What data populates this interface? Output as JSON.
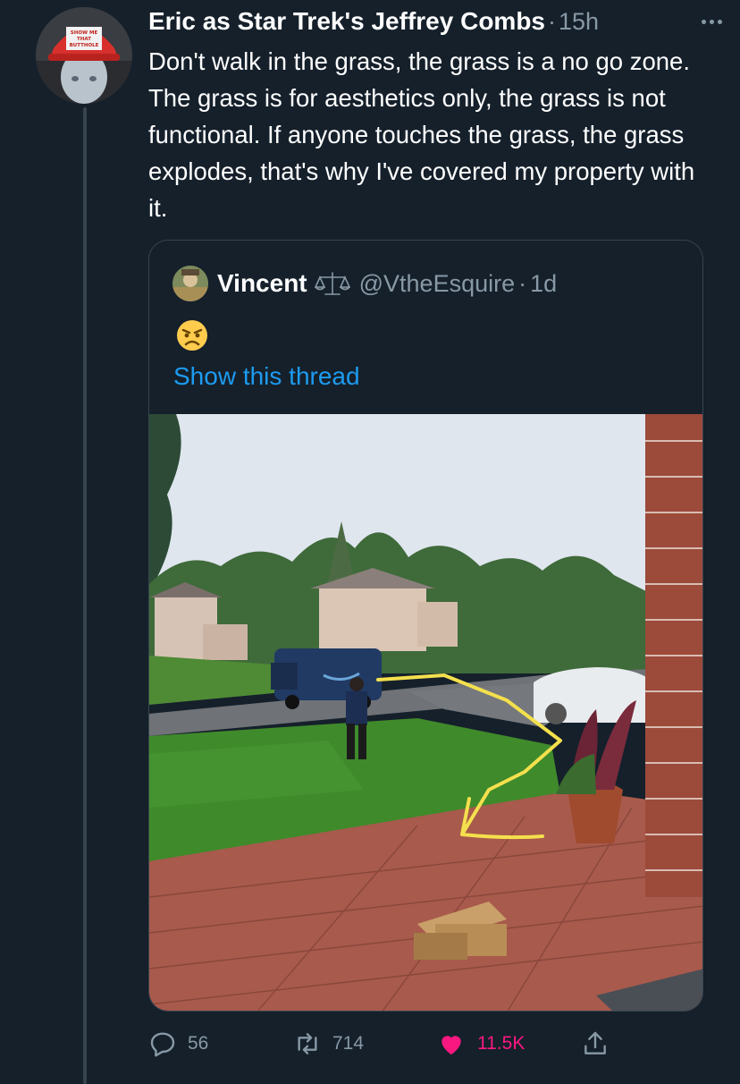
{
  "tweet": {
    "author": {
      "display_name": "Eric as Star Trek's Jeffrey Combs",
      "hat_text": [
        "SHOW ME",
        "THAT",
        "BUTTHOLE"
      ]
    },
    "separator": "·",
    "time": "15h",
    "text": "Don't walk in the grass, the grass is a no go zone. The grass is for aesthetics only, the grass is not functional. If anyone touches the grass, the grass explodes, that's why I've covered my property with it."
  },
  "quote": {
    "display_name": "Vincent",
    "handle": "@VtheEsquire",
    "separator": "·",
    "time": "1d",
    "emoji": "angry-face",
    "show_thread": "Show this thread",
    "media": {
      "description_icon": "photo"
    }
  },
  "actions": {
    "reply_count": "56",
    "retweet_count": "714",
    "like_count": "11.5K"
  },
  "colors": {
    "background": "#15202b",
    "border": "#38444d",
    "secondary_text": "#8899a6",
    "link": "#1d9bf0",
    "like": "#f91880"
  }
}
